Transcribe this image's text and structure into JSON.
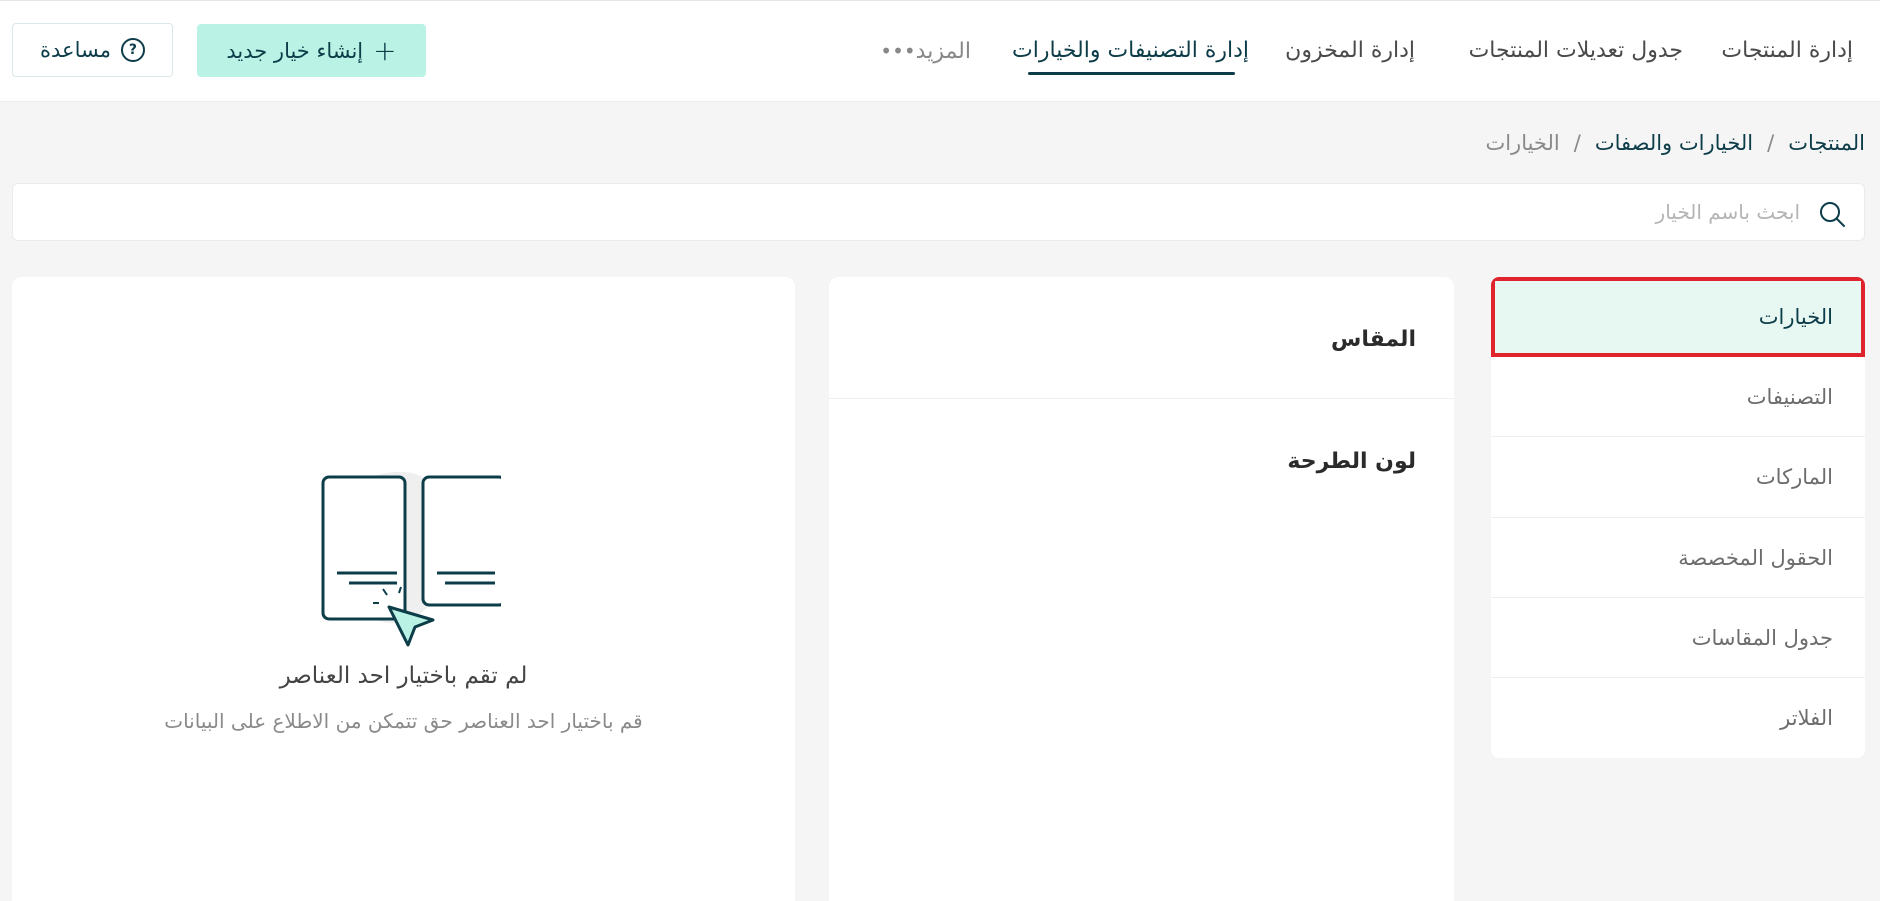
{
  "nav": {
    "tabs": [
      {
        "label": "إدارة المنتجات"
      },
      {
        "label": "جدول تعديلات المنتجات"
      },
      {
        "label": "إدارة المخزون"
      },
      {
        "label": "إدارة التصنيفات والخيارات"
      },
      {
        "label": "المزيد"
      }
    ],
    "active_tab": "إدارة التصنيفات والخيارات",
    "create_button": "إنشاء خيار جديد",
    "help_button": "مساعدة"
  },
  "breadcrumb": [
    "المنتجات",
    "الخيارات والصفات",
    "الخيارات"
  ],
  "breadcrumb_separator": "/",
  "search": {
    "placeholder": "ابحث باسم الخيار",
    "value": ""
  },
  "sidebar": {
    "items": [
      {
        "label": "الخيارات"
      },
      {
        "label": "التصنيفات"
      },
      {
        "label": "الماركات"
      },
      {
        "label": "الحقول المخصصة"
      },
      {
        "label": "جدول المقاسات"
      },
      {
        "label": "الفلاتر"
      }
    ],
    "active": "الخيارات"
  },
  "options": [
    {
      "label": "المقاس"
    },
    {
      "label": "لون الطرحة"
    }
  ],
  "empty_state": {
    "title": "لم تقم باختيار احد العناصر",
    "subtitle": "قم باختيار احد العناصر حق تتمكن من الاطلاع على البيانات"
  },
  "colors": {
    "primary": "#0e3d4a",
    "accent_mint": "#baf3e6",
    "active_bg": "#e7f8f3",
    "highlight_border": "#e0242d",
    "page_bg": "#f5f5f5"
  },
  "icons": {
    "search": "search-icon",
    "help": "question-circle-icon",
    "create": "plus-icon",
    "more": "ellipsis-icon",
    "empty": "select-item-illustration"
  }
}
